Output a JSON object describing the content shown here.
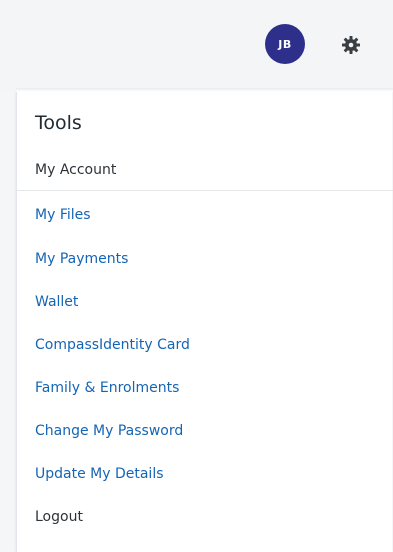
{
  "header": {
    "avatar_initials": "JB",
    "avatar_color": "#2e2f8a",
    "settings_icon": "gear-icon"
  },
  "menu": {
    "title": "Tools",
    "account_label": "My Account",
    "items": [
      {
        "label": "My Files"
      },
      {
        "label": "My Payments"
      },
      {
        "label": "Wallet"
      },
      {
        "label": "CompassIdentity Card"
      },
      {
        "label": "Family & Enrolments"
      },
      {
        "label": "Change My Password"
      },
      {
        "label": "Update My Details"
      },
      {
        "label": "Logout"
      }
    ],
    "link_color": "#1565b5"
  }
}
